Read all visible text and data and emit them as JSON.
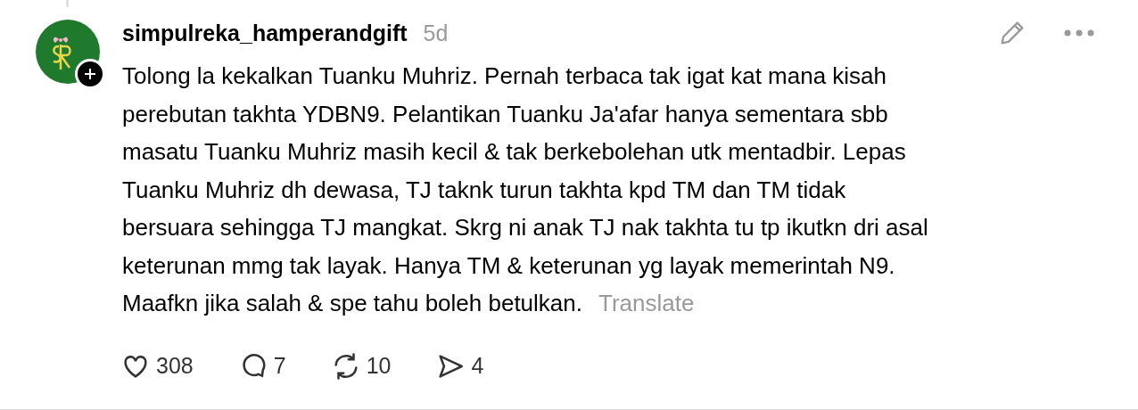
{
  "post": {
    "username": "simpulreka_hamperandgift",
    "time": "5d",
    "lines": [
      "Tolong la kekalkan Tuanku Muhriz. Pernah terbaca tak igat kat mana kisah",
      "perebutan takhta YDBN9. Pelantikan Tuanku Ja'afar hanya sementara sbb",
      "masatu Tuanku Muhriz masih kecil & tak berkebolehan utk mentadbir. Lepas",
      "Tuanku Muhriz dh dewasa, TJ taknk turun takhta kpd TM dan TM tidak",
      "bersuara sehingga TJ mangkat. Skrg ni anak TJ nak takhta tu tp ikutkn dri asal",
      "keterunan mmg tak layak. Hanya TM & keterunan yg layak memerintah N9.",
      "Maafkn jika salah & spe tahu boleh betulkan."
    ],
    "translate": "Translate",
    "actions": [
      {
        "kind": "like",
        "count": "308"
      },
      {
        "kind": "reply",
        "count": "7"
      },
      {
        "kind": "repost",
        "count": "10"
      },
      {
        "kind": "share",
        "count": "4"
      }
    ]
  }
}
